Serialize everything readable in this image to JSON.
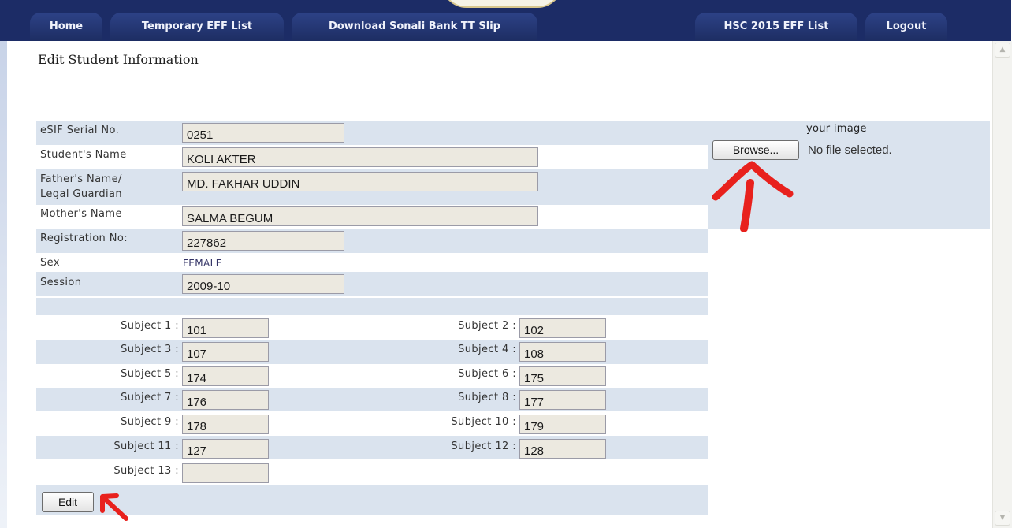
{
  "nav": {
    "left_tabs": [
      "Home",
      "Temporary EFF List",
      "Download Sonali Bank TT Slip"
    ],
    "right_tabs": [
      "HSC 2015 EFF List",
      "Logout"
    ]
  },
  "page": {
    "title": "Edit Student Information"
  },
  "form": {
    "serial": {
      "label": "eSIF Serial No.",
      "value": "0251"
    },
    "student_name": {
      "label": "Student's Name",
      "value": "KOLI AKTER"
    },
    "father": {
      "label_line1": "Father's Name/",
      "label_line2": "Legal Guardian",
      "value": "MD. FAKHAR UDDIN"
    },
    "mother": {
      "label": "Mother's Name",
      "value": "SALMA BEGUM"
    },
    "registration": {
      "label": "Registration No:",
      "value": "227862"
    },
    "sex": {
      "label": "Sex",
      "value": "FEMALE"
    },
    "session": {
      "label": "Session",
      "value": "2009-10"
    }
  },
  "subjects": [
    {
      "label": "Subject 1 :",
      "value": "101"
    },
    {
      "label": "Subject 2 :",
      "value": "102"
    },
    {
      "label": "Subject 3 :",
      "value": "107"
    },
    {
      "label": "Subject 4 :",
      "value": "108"
    },
    {
      "label": "Subject 5 :",
      "value": "174"
    },
    {
      "label": "Subject 6 :",
      "value": "175"
    },
    {
      "label": "Subject 7 :",
      "value": "176"
    },
    {
      "label": "Subject 8 :",
      "value": "177"
    },
    {
      "label": "Subject 9 :",
      "value": "178"
    },
    {
      "label": "Subject 10 :",
      "value": "179"
    },
    {
      "label": "Subject 11 :",
      "value": "127"
    },
    {
      "label": "Subject 12 :",
      "value": "128"
    },
    {
      "label": "Subject 13 :",
      "value": ""
    }
  ],
  "upload": {
    "hint": "your image",
    "browse_label": "Browse...",
    "status": "No file selected."
  },
  "actions": {
    "edit_label": "Edit"
  },
  "icons": {
    "arrows": [
      "red-arrow-up-icon",
      "red-arrow-diagonal-icon"
    ],
    "scroll": [
      "scroll-up-icon",
      "scroll-down-icon"
    ]
  },
  "colors": {
    "navbar": "#1c2c66",
    "band": "#dae3ee",
    "field_bg": "#ece9e0",
    "annotation_arrow": "#e8211d"
  }
}
